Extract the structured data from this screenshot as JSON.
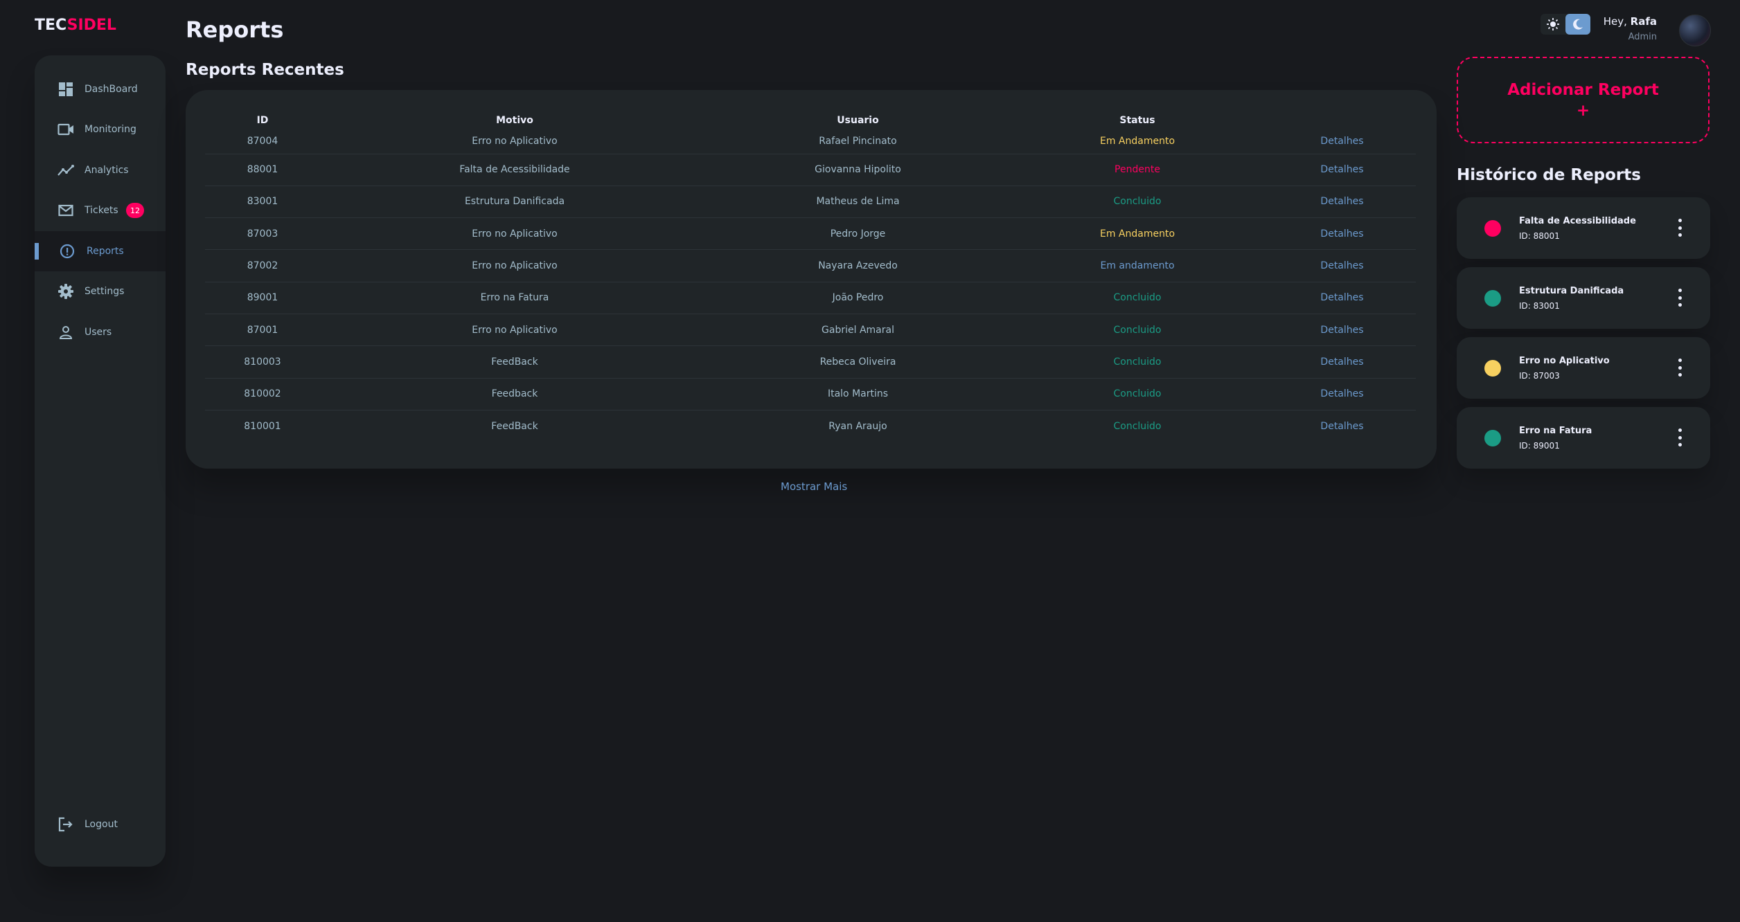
{
  "brand": {
    "part1": "TEC",
    "part2": "SIDEL"
  },
  "sidebar": {
    "items": [
      {
        "label": "DashBoard",
        "icon": "grid-icon"
      },
      {
        "label": "Monitoring",
        "icon": "videocam-icon"
      },
      {
        "label": "Analytics",
        "icon": "insights-icon"
      },
      {
        "label": "Tickets",
        "icon": "mail-icon",
        "badge": "12"
      },
      {
        "label": "Reports",
        "icon": "report-icon",
        "active": true
      },
      {
        "label": "Settings",
        "icon": "gear-icon"
      },
      {
        "label": "Users",
        "icon": "person-icon"
      }
    ],
    "logout": "Logout"
  },
  "header": {
    "title": "Reports",
    "greeting": "Hey,",
    "user_name": "Rafa",
    "user_role": "Admin"
  },
  "recent": {
    "title": "Reports Recentes",
    "columns": [
      "ID",
      "Motivo",
      "Usuario",
      "Status"
    ],
    "rows": [
      {
        "id": "87004",
        "motivo": "Erro no Aplicativo",
        "usuario": "Rafael Pincinato",
        "status": "Em Andamento",
        "status_type": "warning",
        "link": "Detalhes"
      },
      {
        "id": "88001",
        "motivo": "Falta de Acessibilidade",
        "usuario": "Giovanna Hipolito",
        "status": "Pendente",
        "status_type": "danger",
        "link": "Detalhes"
      },
      {
        "id": "83001",
        "motivo": "Estrutura Danificada",
        "usuario": "Matheus de Lima",
        "status": "Concluido",
        "status_type": "success",
        "link": "Detalhes"
      },
      {
        "id": "87003",
        "motivo": "Erro no Aplicativo",
        "usuario": "Pedro Jorge",
        "status": "Em Andamento",
        "status_type": "warning",
        "link": "Detalhes"
      },
      {
        "id": "87002",
        "motivo": "Erro no Aplicativo",
        "usuario": "Nayara Azevedo",
        "status": "Em andamento",
        "status_type": "primary",
        "link": "Detalhes"
      },
      {
        "id": "89001",
        "motivo": "Erro na Fatura",
        "usuario": "João Pedro",
        "status": "Concluido",
        "status_type": "success",
        "link": "Detalhes"
      },
      {
        "id": "87001",
        "motivo": "Erro no Aplicativo",
        "usuario": "Gabriel Amaral",
        "status": "Concluido",
        "status_type": "success",
        "link": "Detalhes"
      },
      {
        "id": "810003",
        "motivo": "FeedBack",
        "usuario": "Rebeca Oliveira",
        "status": "Concluido",
        "status_type": "success",
        "link": "Detalhes"
      },
      {
        "id": "810002",
        "motivo": "Feedback",
        "usuario": "Italo Martins",
        "status": "Concluido",
        "status_type": "success",
        "link": "Detalhes"
      },
      {
        "id": "810001",
        "motivo": "FeedBack",
        "usuario": "Ryan Araujo",
        "status": "Concluido",
        "status_type": "success",
        "link": "Detalhes"
      }
    ],
    "show_more": "Mostrar Mais"
  },
  "add_report": {
    "label": "Adicionar Report",
    "plus": "+"
  },
  "history": {
    "title": "Histórico de Reports",
    "items": [
      {
        "name": "Falta de Acessibilidade",
        "id_text": "ID: 88001",
        "color": "#ff0060"
      },
      {
        "name": "Estrutura Danificada",
        "id_text": "ID: 83001",
        "color": "#1b9c85"
      },
      {
        "name": "Erro no Aplicativo",
        "id_text": "ID: 87003",
        "color": "#f7d060"
      },
      {
        "name": "Erro na Fatura",
        "id_text": "ID: 89001",
        "color": "#1b9c85"
      }
    ]
  },
  "colors": {
    "background": "#181a1e",
    "card": "#202528",
    "primary": "#6c9bcf",
    "danger": "#ff0060",
    "success": "#1b9c85",
    "warning": "#f7d060"
  }
}
